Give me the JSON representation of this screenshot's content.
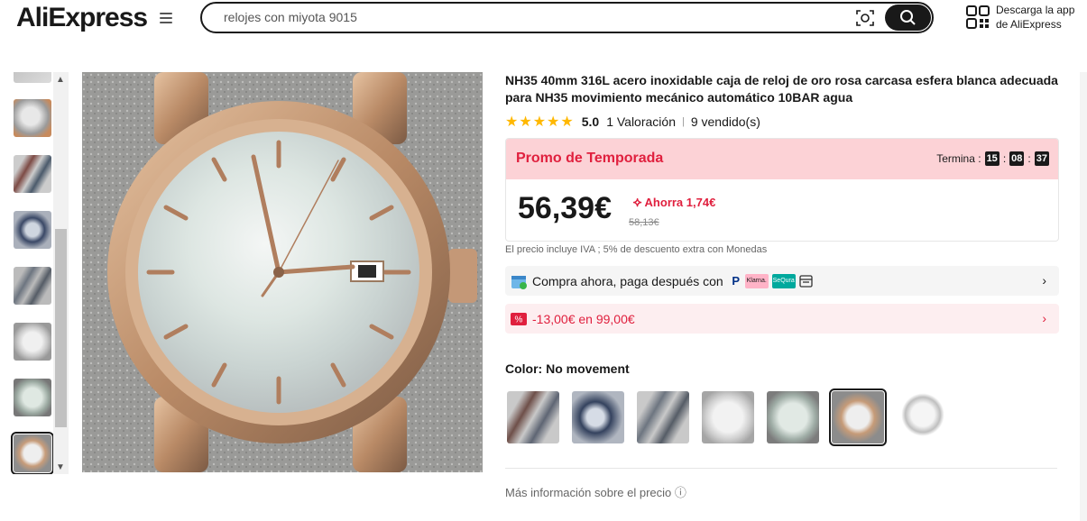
{
  "header": {
    "logo": "AliExpress",
    "search_value": "relojes con miyota 9015",
    "app_line1": "Descarga la app",
    "app_line2": "de AliExpress"
  },
  "product": {
    "title": "NH35 40mm 316L acero inoxidable caja de reloj de oro rosa carcasa esfera blanca adecuada para NH35 movimiento mecánico automático 10BAR agua",
    "stars": "★★★★★",
    "rating": "5.0",
    "reviews": "1 Valoración",
    "sold": "9 vendido(s)"
  },
  "promo": {
    "title": "Promo de Temporada",
    "ends_label": "Termina :",
    "hours": "15",
    "minutes": "08",
    "seconds": "37",
    "price": "56,39€",
    "savings": "Ahorra 1,74€",
    "old_price": "58,13€"
  },
  "tax_note": "El precio incluye IVA ; 5% de descuento extra con Monedas",
  "payment": {
    "text": "Compra ahora, paga después con",
    "logos": [
      "PayPal",
      "Klarna.",
      "SeQura"
    ]
  },
  "coupon": {
    "text": "-13,00€ en 99,00€"
  },
  "color": {
    "label": "Color:",
    "value": "No movement"
  },
  "more_info": "Más información sobre el precio",
  "colors": {
    "accent": "#e0203e",
    "promo_bg": "#fcd2d6",
    "star": "#ffb800"
  }
}
